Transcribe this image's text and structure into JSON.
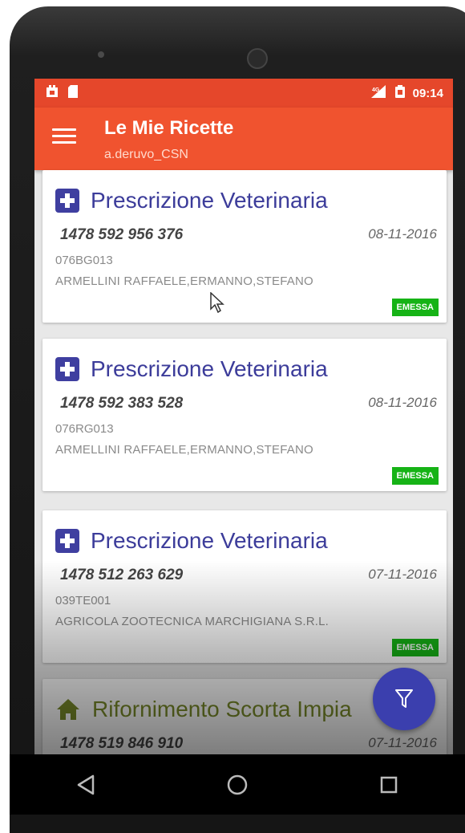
{
  "statusbar": {
    "time": "09:14",
    "network": "4G"
  },
  "appbar": {
    "title": "Le Mie Ricette",
    "subtitle": "a.deruvo_CSN"
  },
  "prescriptions": [
    {
      "title": "Prescrizione Veterinaria",
      "number": "1478 592 956 376",
      "date": "08-11-2016",
      "code": "076BG013",
      "name": "ARMELLINI RAFFAELE,ERMANNO,STEFANO",
      "status": "EMESSA"
    },
    {
      "title": "Prescrizione Veterinaria",
      "number": "1478 592 383 528",
      "date": "08-11-2016",
      "code": "076RG013",
      "name": "ARMELLINI RAFFAELE,ERMANNO,STEFANO",
      "status": "EMESSA"
    },
    {
      "title": "Prescrizione Veterinaria",
      "number": "1478 512 263 629",
      "date": "07-11-2016",
      "code": "039TE001",
      "name": "AGRICOLA ZOOTECNICA MARCHIGIANA S.R.L.",
      "status": "EMESSA"
    },
    {
      "title": "Rifornimento Scorta Impia",
      "number": "1478 519 846 910",
      "date": "07-11-2016"
    }
  ],
  "icons": {
    "menu": "hamburger-menu-icon",
    "prescription": "plus-cross-icon",
    "restock": "home-icon",
    "fab": "filter-icon",
    "nav_back": "back-triangle-icon",
    "nav_home": "home-circle-icon",
    "nav_recents": "recents-square-icon"
  },
  "colors": {
    "statusbar": "#e5472b",
    "appbar": "#f0532f",
    "accent": "#3f3fa0",
    "badge": "#16b316",
    "restock_title": "#7a8c2a"
  }
}
